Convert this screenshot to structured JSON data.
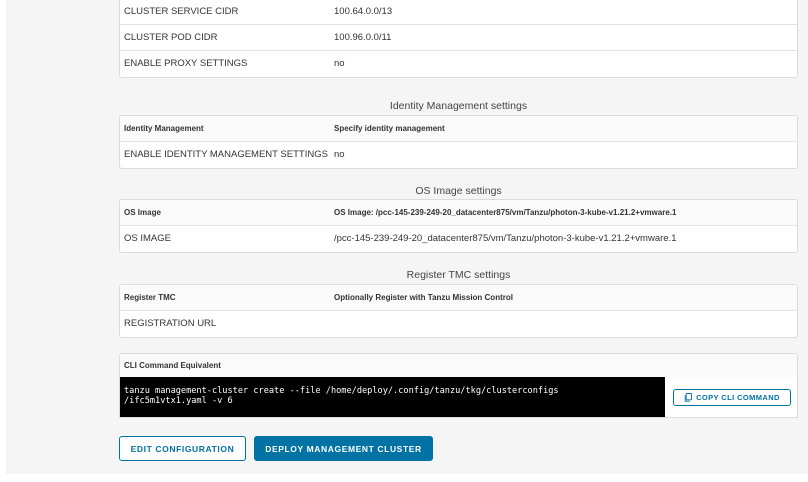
{
  "network": {
    "rows": [
      {
        "key": "CLUSTER SERVICE CIDR",
        "value": "100.64.0.0/13"
      },
      {
        "key": "CLUSTER POD CIDR",
        "value": "100.96.0.0/11"
      },
      {
        "key": "ENABLE PROXY SETTINGS",
        "value": "no"
      }
    ]
  },
  "identity": {
    "title": "Identity Management settings",
    "header_key": "Identity Management",
    "header_value": "Specify identity management",
    "rows": [
      {
        "key": "ENABLE IDENTITY MANAGEMENT SETTINGS",
        "value": "no"
      }
    ]
  },
  "os_image": {
    "title": "OS Image settings",
    "header_key": "OS Image",
    "header_value": "OS Image: /pcc-145-239-249-20_datacenter875/vm/Tanzu/photon-3-kube-v1.21.2+vmware.1",
    "rows": [
      {
        "key": "OS IMAGE",
        "value": "/pcc-145-239-249-20_datacenter875/vm/Tanzu/photon-3-kube-v1.21.2+vmware.1"
      }
    ]
  },
  "tmc": {
    "title": "Register TMC settings",
    "header_key": "Register TMC",
    "header_value": "Optionally Register with Tanzu Mission Control",
    "rows": [
      {
        "key": "REGISTRATION URL",
        "value": ""
      }
    ]
  },
  "cli": {
    "header": "CLI Command Equivalent",
    "command": "tanzu management-cluster create --file /home/deploy/.config/tanzu/tkg/clusterconfigs\n/ifc5m1vtx1.yaml -v 6",
    "copy_label": "COPY CLI COMMAND",
    "copy_icon": "copy-icon"
  },
  "actions": {
    "edit_label": "EDIT CONFIGURATION",
    "deploy_label": "DEPLOY MANAGEMENT CLUSTER"
  },
  "colors": {
    "primary": "#0072a3",
    "terminal_bg": "#000000",
    "panel_bg": "#f5f5f5"
  }
}
